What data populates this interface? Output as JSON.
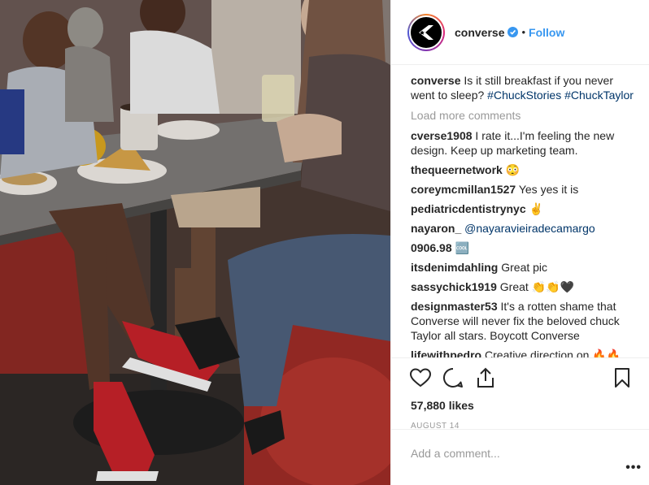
{
  "post": {
    "username": "converse",
    "dot": "•",
    "follow_label": "Follow",
    "caption_user": "converse",
    "caption_text": " Is it still breakfast if you never went to sleep? ",
    "caption_tag1": "#ChuckStories",
    "caption_tag2": "#ChuckTaylor",
    "load_more": "Load more comments",
    "likes": "57,880 likes",
    "date": "AUGUST 14",
    "comment_placeholder": "Add a comment...",
    "more_options": "•••"
  },
  "comments": [
    {
      "user": "cverse1908",
      "text": " I rate it...I'm feeling the new design. Keep up marketing team."
    },
    {
      "user": "thequeernetwork",
      "text": " 😳"
    },
    {
      "user": "coreymcmillan1527",
      "text": " Yes yes it is"
    },
    {
      "user": "pediatricdentistrynyc",
      "text": " ✌️"
    },
    {
      "user": "nayaron_",
      "text": " ",
      "mention": "@nayaravieiradecamargo"
    },
    {
      "user": "0906.98",
      "text": " 🆒"
    },
    {
      "user": "itsdenimdahling",
      "text": " Great pic"
    },
    {
      "user": "sassychick1919",
      "text": " Great 👏👏🖤"
    },
    {
      "user": "designmaster53",
      "text": " It's a rotten shame that Converse will never fix the beloved chuck Taylor all stars. Boycott Converse"
    },
    {
      "user": "lifewithpedro",
      "text": " Creative direction on 🔥🔥🔥"
    }
  ],
  "colors": {
    "link": "#3897f0",
    "hashtag": "#003569",
    "muted": "#999999",
    "text": "#262626"
  },
  "icons": [
    "verified-badge-icon",
    "heart-icon",
    "comment-icon",
    "share-icon",
    "bookmark-icon",
    "converse-logo-icon"
  ]
}
